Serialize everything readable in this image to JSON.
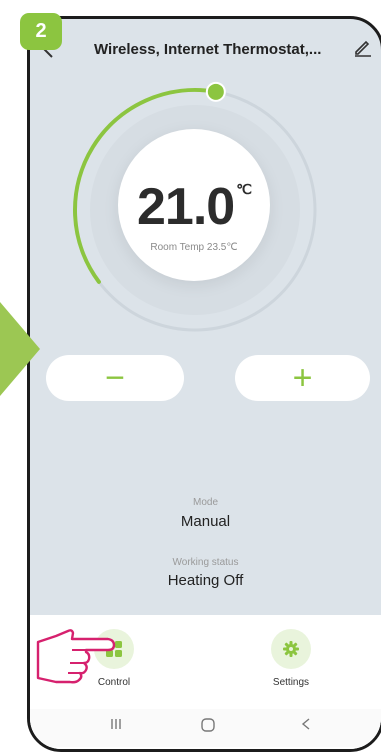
{
  "step_badge": "2",
  "header": {
    "title": "Wireless, Internet Thermostat,...",
    "back_icon": "chevron-left-icon",
    "edit_icon": "pencil-icon"
  },
  "thermostat": {
    "set_temp": "21.0",
    "unit": "℃",
    "room_temp": "Room Temp 23.5℃",
    "dial_level": 0.38
  },
  "controls": {
    "minus": "−",
    "plus": "+"
  },
  "status": {
    "mode_label": "Mode",
    "mode_value": "Manual",
    "working_label": "Working status",
    "working_value": "Heating Off"
  },
  "bottom_nav": [
    {
      "label": "Control",
      "icon": "grid-icon"
    },
    {
      "label": "Settings",
      "icon": "gear-icon"
    }
  ],
  "colors": {
    "accent": "#8cc540",
    "background": "#dce3e9",
    "annotation": "#d6216e"
  }
}
